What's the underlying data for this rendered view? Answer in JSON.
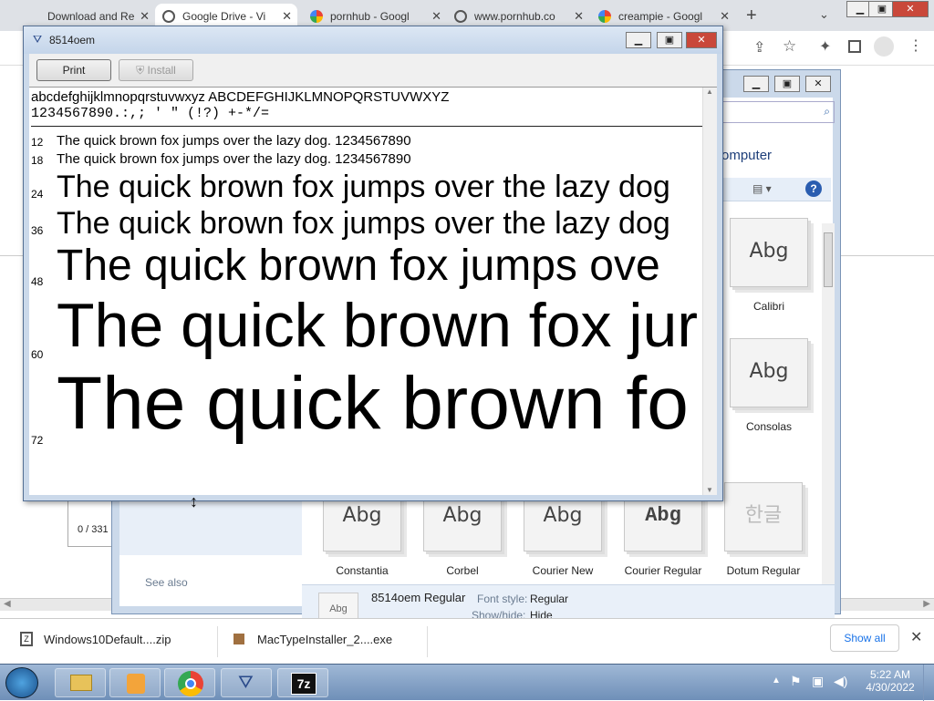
{
  "browser": {
    "tabs": [
      {
        "title": "Download and Re",
        "active": false
      },
      {
        "title": "Google Drive - Vi",
        "active": true
      },
      {
        "title": "pornhub - Googl",
        "active": false
      },
      {
        "title": "www.pornhub.co",
        "active": false
      },
      {
        "title": "creampie - Googl",
        "active": false
      }
    ],
    "new_tab": "+",
    "menu_icon": "chevron-down-icon"
  },
  "viewer": {
    "title": "8514oem",
    "print_label": "Print",
    "install_label": "Install",
    "charset_lower": "abcdefghijklmnopqrstuvwxyz ABCDEFGHIJKLMNOPQRSTUVWXYZ",
    "charset_digits": "1234567890.:,; ' \" (!?) +-*/=",
    "samples": [
      {
        "size": "12",
        "text": "The quick brown fox jumps over the lazy dog. 1234567890"
      },
      {
        "size": "18",
        "text": "The quick brown fox jumps over the lazy dog. 1234567890"
      },
      {
        "size": "24",
        "text": "The quick brown fox jumps over the lazy dog"
      },
      {
        "size": "36",
        "text": "The quick brown fox jumps over the lazy dog"
      },
      {
        "size": "48",
        "text": "The quick brown fox jumps ove"
      },
      {
        "size": "60",
        "text": "The quick brown fox jur"
      },
      {
        "size": "72",
        "text": "The quick brown fo"
      }
    ]
  },
  "explorer": {
    "header_text": "omputer",
    "see_also": "See also",
    "fonts": [
      {
        "name": "Calibri",
        "preview": "Abg"
      },
      {
        "name": "Consolas",
        "preview": "Abg"
      },
      {
        "name": "Constantia",
        "preview": "Abg"
      },
      {
        "name": "Corbel",
        "preview": "Abg"
      },
      {
        "name": "Courier New",
        "preview": "Abg"
      },
      {
        "name": "Courier Regular",
        "preview": "Abg"
      },
      {
        "name": "Dotum Regular",
        "preview": "한글"
      }
    ],
    "details": {
      "preview": "Abg",
      "name": "8514oem Regular",
      "style_label": "Font style:",
      "style_value": "Regular",
      "showhide_label": "Show/hide:",
      "showhide_value": "Hide"
    }
  },
  "bg_window": {
    "counter": "0 / 331"
  },
  "downloads": {
    "items": [
      {
        "name": "Windows10Default....zip"
      },
      {
        "name": "MacTypeInstaller_2....exe"
      }
    ],
    "show_all": "Show all"
  },
  "taskbar": {
    "time": "5:22 AM",
    "date": "4/30/2022"
  }
}
